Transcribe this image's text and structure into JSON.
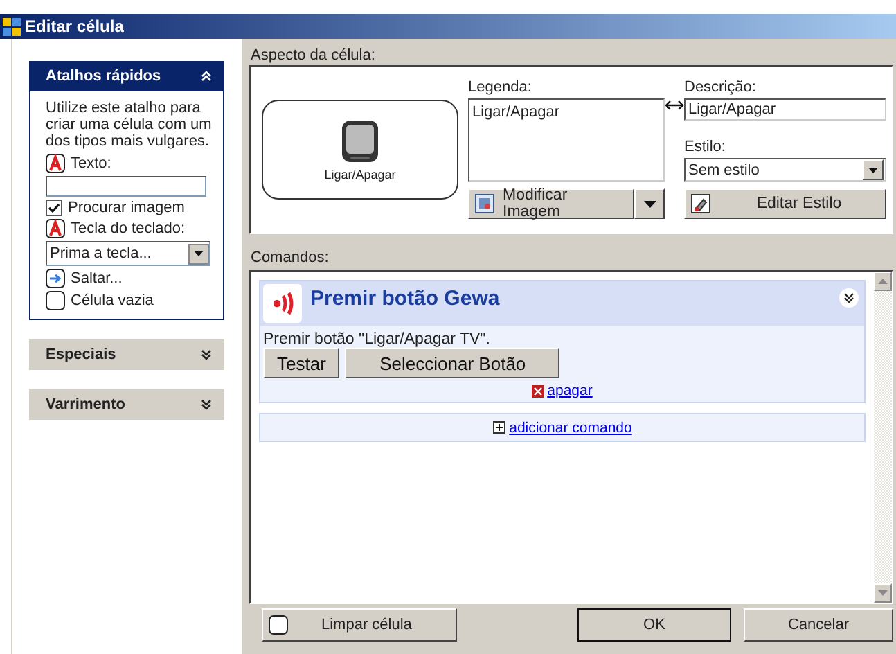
{
  "window": {
    "title": "Editar célula"
  },
  "sidebar": {
    "sections": [
      {
        "title": "Atalhos rápidos",
        "expanded": true,
        "intro": "Utilize este atalho para criar uma célula com um dos tipos mais vulgares.",
        "text_label": "Texto:",
        "search_image": {
          "label": "Procurar imagem",
          "checked": true
        },
        "key_label": "Tecla do teclado:",
        "key_select": "Prima a tecla...",
        "jump_link": "Saltar...",
        "empty_cell_link": "Célula vazia"
      },
      {
        "title": "Especiais",
        "expanded": false
      },
      {
        "title": "Varrimento",
        "expanded": false
      }
    ]
  },
  "appearance": {
    "label": "Aspecto da célula:",
    "preview_caption": "Ligar/Apagar",
    "legend_label": "Legenda:",
    "legend_value": "Ligar/Apagar",
    "description_label": "Descrição:",
    "description_value": "Ligar/Apagar",
    "style_label": "Estilo:",
    "style_value": "Sem estilo",
    "modify_image_button": "Modificar Imagem",
    "edit_style_button": "Editar Estilo"
  },
  "commands": {
    "label": "Comandos:",
    "items": [
      {
        "title": "Premir botão Gewa",
        "description": "Premir botão \"Ligar/Apagar TV\".",
        "buttons": [
          "Testar",
          "Seleccionar Botão"
        ],
        "delete_link": "apagar"
      }
    ],
    "add_link": "adicionar comando"
  },
  "footer": {
    "clear_button": "Limpar célula",
    "ok_button": "OK",
    "cancel_button": "Cancelar"
  }
}
